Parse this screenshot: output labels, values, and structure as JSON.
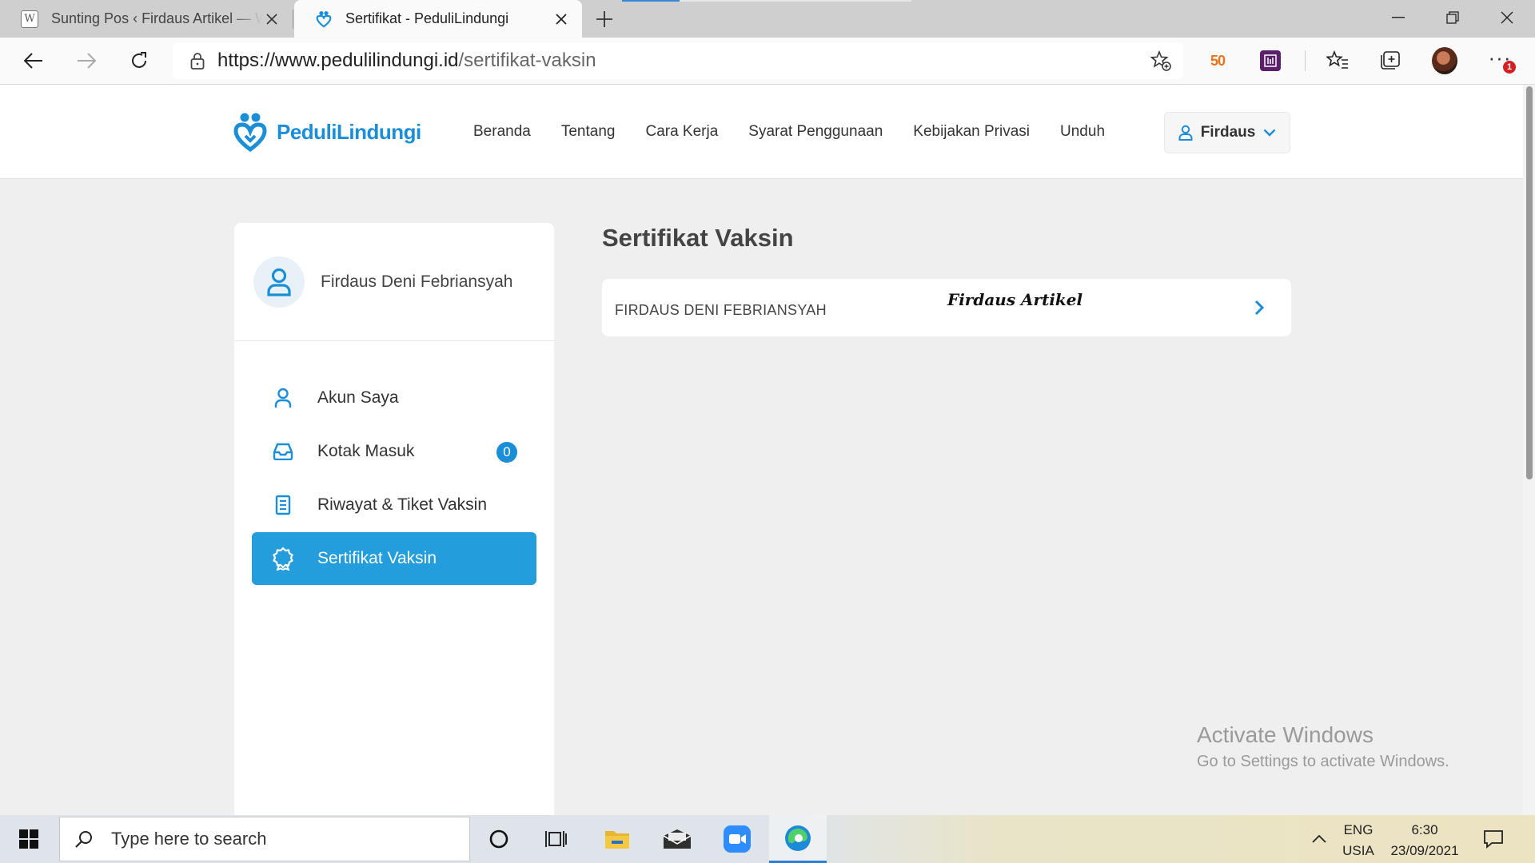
{
  "browser": {
    "tabs": [
      {
        "title": "Sunting Pos ‹ Firdaus Artikel — W",
        "active": false
      },
      {
        "title": "Sertifikat - PeduliLindungi",
        "active": true
      }
    ],
    "url_host": "https://www.pedulilindungi.id",
    "url_path": "/sertifikat-vaksin",
    "extension_badge": "1",
    "ext_50_text": "50"
  },
  "site": {
    "brand": "PeduliLindungi",
    "nav": [
      "Beranda",
      "Tentang",
      "Cara Kerja",
      "Syarat Penggunaan",
      "Kebijakan Privasi",
      "Unduh"
    ],
    "user_button": "Firdaus",
    "accent_color": "#249ddc"
  },
  "sidebar": {
    "profile_name": "Firdaus Deni Febriansyah",
    "menu": [
      {
        "label": "Akun Saya",
        "icon": "user-icon",
        "active": false
      },
      {
        "label": "Kotak Masuk",
        "icon": "inbox-icon",
        "active": false,
        "count": "0"
      },
      {
        "label": "Riwayat & Tiket Vaksin",
        "icon": "document-icon",
        "active": false
      },
      {
        "label": "Sertifikat Vaksin",
        "icon": "award-icon",
        "active": true
      }
    ]
  },
  "main": {
    "title": "Sertifikat Vaksin",
    "certificates": [
      {
        "name": "FIRDAUS DENI FEBRIANSYAH"
      }
    ],
    "watermark": "Firdaus Artikel"
  },
  "os": {
    "activate_title": "Activate Windows",
    "activate_subtitle": "Go to Settings to activate Windows.",
    "search_placeholder": "Type here to search",
    "lang_top": "ENG",
    "lang_bottom": "USIA",
    "time": "6:30",
    "date": "23/09/2021"
  }
}
